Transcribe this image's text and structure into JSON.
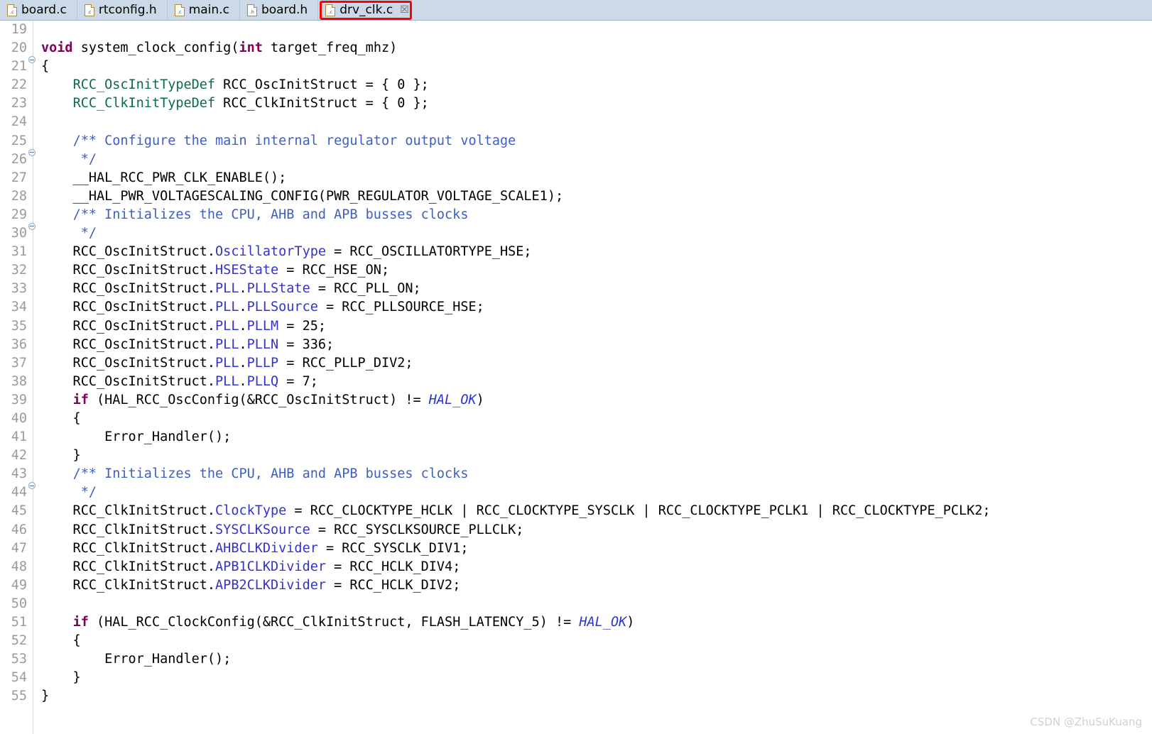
{
  "tabbar": {
    "tabs": [
      {
        "label": "board.c",
        "ext": ".c",
        "kind": "c",
        "active": false,
        "closable": false
      },
      {
        "label": "rtconfig.h",
        "ext": ".c",
        "kind": "c",
        "active": false,
        "closable": false
      },
      {
        "label": "main.c",
        "ext": ".c",
        "kind": "c",
        "active": false,
        "closable": false
      },
      {
        "label": "board.h",
        "ext": ".h",
        "kind": "h",
        "active": false,
        "closable": false
      },
      {
        "label": "drv_clk.c",
        "ext": ".c",
        "kind": "c",
        "active": true,
        "closable": true
      }
    ],
    "close_glyph": "☒",
    "highlight_color": "#ff0000"
  },
  "editor": {
    "language": "C",
    "first_line": 19,
    "last_line": 55,
    "fold_lines": [
      20,
      25,
      29,
      43
    ],
    "fold_glyph": "⊖",
    "colors": {
      "keyword": "#7f0055",
      "type": "#0a6b4a",
      "member": "#3333cc",
      "comment": "#3f5fbf",
      "enum_constant": "#2a36c8",
      "text": "#000000",
      "line_number": "#9a9a9a",
      "background": "#ffffff",
      "tab_background": "#ccd9e8"
    },
    "lines": [
      {
        "n": 19,
        "fold": false,
        "tokens": []
      },
      {
        "n": 20,
        "fold": true,
        "tokens": [
          {
            "t": "kw",
            "s": "void"
          },
          {
            "t": "p",
            "s": " system_clock_config("
          },
          {
            "t": "kw",
            "s": "int"
          },
          {
            "t": "p",
            "s": " target_freq_mhz)"
          }
        ]
      },
      {
        "n": 21,
        "fold": false,
        "tokens": [
          {
            "t": "p",
            "s": "{"
          }
        ]
      },
      {
        "n": 22,
        "fold": false,
        "tokens": [
          {
            "t": "p",
            "s": "    "
          },
          {
            "t": "type",
            "s": "RCC_OscInitTypeDef"
          },
          {
            "t": "p",
            "s": " RCC_OscInitStruct = { 0 };"
          }
        ]
      },
      {
        "n": 23,
        "fold": false,
        "tokens": [
          {
            "t": "p",
            "s": "    "
          },
          {
            "t": "type",
            "s": "RCC_ClkInitTypeDef"
          },
          {
            "t": "p",
            "s": " RCC_ClkInitStruct = { 0 };"
          }
        ]
      },
      {
        "n": 24,
        "fold": false,
        "tokens": []
      },
      {
        "n": 25,
        "fold": true,
        "tokens": [
          {
            "t": "p",
            "s": "    "
          },
          {
            "t": "cmt",
            "s": "/** Configure the main internal regulator output voltage"
          }
        ]
      },
      {
        "n": 26,
        "fold": false,
        "tokens": [
          {
            "t": "p",
            "s": "     "
          },
          {
            "t": "cmt",
            "s": "*/"
          }
        ]
      },
      {
        "n": 27,
        "fold": false,
        "tokens": [
          {
            "t": "p",
            "s": "    __HAL_RCC_PWR_CLK_ENABLE();"
          }
        ]
      },
      {
        "n": 28,
        "fold": false,
        "tokens": [
          {
            "t": "p",
            "s": "    __HAL_PWR_VOLTAGESCALING_CONFIG(PWR_REGULATOR_VOLTAGE_SCALE1);"
          }
        ]
      },
      {
        "n": 29,
        "fold": true,
        "tokens": [
          {
            "t": "p",
            "s": "    "
          },
          {
            "t": "cmt",
            "s": "/** Initializes the CPU, AHB and APB busses clocks"
          }
        ]
      },
      {
        "n": 30,
        "fold": false,
        "tokens": [
          {
            "t": "p",
            "s": "     "
          },
          {
            "t": "cmt",
            "s": "*/"
          }
        ]
      },
      {
        "n": 31,
        "fold": false,
        "tokens": [
          {
            "t": "p",
            "s": "    RCC_OscInitStruct."
          },
          {
            "t": "mem",
            "s": "OscillatorType"
          },
          {
            "t": "p",
            "s": " = RCC_OSCILLATORTYPE_HSE;"
          }
        ]
      },
      {
        "n": 32,
        "fold": false,
        "tokens": [
          {
            "t": "p",
            "s": "    RCC_OscInitStruct."
          },
          {
            "t": "mem",
            "s": "HSEState"
          },
          {
            "t": "p",
            "s": " = RCC_HSE_ON;"
          }
        ]
      },
      {
        "n": 33,
        "fold": false,
        "tokens": [
          {
            "t": "p",
            "s": "    RCC_OscInitStruct."
          },
          {
            "t": "mem",
            "s": "PLL"
          },
          {
            "t": "p",
            "s": "."
          },
          {
            "t": "mem",
            "s": "PLLState"
          },
          {
            "t": "p",
            "s": " = RCC_PLL_ON;"
          }
        ]
      },
      {
        "n": 34,
        "fold": false,
        "tokens": [
          {
            "t": "p",
            "s": "    RCC_OscInitStruct."
          },
          {
            "t": "mem",
            "s": "PLL"
          },
          {
            "t": "p",
            "s": "."
          },
          {
            "t": "mem",
            "s": "PLLSource"
          },
          {
            "t": "p",
            "s": " = RCC_PLLSOURCE_HSE;"
          }
        ]
      },
      {
        "n": 35,
        "fold": false,
        "tokens": [
          {
            "t": "p",
            "s": "    RCC_OscInitStruct."
          },
          {
            "t": "mem",
            "s": "PLL"
          },
          {
            "t": "p",
            "s": "."
          },
          {
            "t": "mem",
            "s": "PLLM"
          },
          {
            "t": "p",
            "s": " = 25;"
          }
        ]
      },
      {
        "n": 36,
        "fold": false,
        "tokens": [
          {
            "t": "p",
            "s": "    RCC_OscInitStruct."
          },
          {
            "t": "mem",
            "s": "PLL"
          },
          {
            "t": "p",
            "s": "."
          },
          {
            "t": "mem",
            "s": "PLLN"
          },
          {
            "t": "p",
            "s": " = 336;"
          }
        ]
      },
      {
        "n": 37,
        "fold": false,
        "tokens": [
          {
            "t": "p",
            "s": "    RCC_OscInitStruct."
          },
          {
            "t": "mem",
            "s": "PLL"
          },
          {
            "t": "p",
            "s": "."
          },
          {
            "t": "mem",
            "s": "PLLP"
          },
          {
            "t": "p",
            "s": " = RCC_PLLP_DIV2;"
          }
        ]
      },
      {
        "n": 38,
        "fold": false,
        "tokens": [
          {
            "t": "p",
            "s": "    RCC_OscInitStruct."
          },
          {
            "t": "mem",
            "s": "PLL"
          },
          {
            "t": "p",
            "s": "."
          },
          {
            "t": "mem",
            "s": "PLLQ"
          },
          {
            "t": "p",
            "s": " = 7;"
          }
        ]
      },
      {
        "n": 39,
        "fold": false,
        "tokens": [
          {
            "t": "p",
            "s": "    "
          },
          {
            "t": "kw",
            "s": "if"
          },
          {
            "t": "p",
            "s": " (HAL_RCC_OscConfig(&RCC_OscInitStruct) != "
          },
          {
            "t": "enm",
            "s": "HAL_OK"
          },
          {
            "t": "p",
            "s": ")"
          }
        ]
      },
      {
        "n": 40,
        "fold": false,
        "tokens": [
          {
            "t": "p",
            "s": "    {"
          }
        ]
      },
      {
        "n": 41,
        "fold": false,
        "tokens": [
          {
            "t": "p",
            "s": "        Error_Handler();"
          }
        ]
      },
      {
        "n": 42,
        "fold": false,
        "tokens": [
          {
            "t": "p",
            "s": "    }"
          }
        ]
      },
      {
        "n": 43,
        "fold": true,
        "tokens": [
          {
            "t": "p",
            "s": "    "
          },
          {
            "t": "cmt",
            "s": "/** Initializes the CPU, AHB and APB busses clocks"
          }
        ]
      },
      {
        "n": 44,
        "fold": false,
        "tokens": [
          {
            "t": "p",
            "s": "     "
          },
          {
            "t": "cmt",
            "s": "*/"
          }
        ]
      },
      {
        "n": 45,
        "fold": false,
        "tokens": [
          {
            "t": "p",
            "s": "    RCC_ClkInitStruct."
          },
          {
            "t": "mem",
            "s": "ClockType"
          },
          {
            "t": "p",
            "s": " = RCC_CLOCKTYPE_HCLK | RCC_CLOCKTYPE_SYSCLK | RCC_CLOCKTYPE_PCLK1 | RCC_CLOCKTYPE_PCLK2;"
          }
        ]
      },
      {
        "n": 46,
        "fold": false,
        "tokens": [
          {
            "t": "p",
            "s": "    RCC_ClkInitStruct."
          },
          {
            "t": "mem",
            "s": "SYSCLKSource"
          },
          {
            "t": "p",
            "s": " = RCC_SYSCLKSOURCE_PLLCLK;"
          }
        ]
      },
      {
        "n": 47,
        "fold": false,
        "tokens": [
          {
            "t": "p",
            "s": "    RCC_ClkInitStruct."
          },
          {
            "t": "mem",
            "s": "AHBCLKDivider"
          },
          {
            "t": "p",
            "s": " = RCC_SYSCLK_DIV1;"
          }
        ]
      },
      {
        "n": 48,
        "fold": false,
        "tokens": [
          {
            "t": "p",
            "s": "    RCC_ClkInitStruct."
          },
          {
            "t": "mem",
            "s": "APB1CLKDivider"
          },
          {
            "t": "p",
            "s": " = RCC_HCLK_DIV4;"
          }
        ]
      },
      {
        "n": 49,
        "fold": false,
        "tokens": [
          {
            "t": "p",
            "s": "    RCC_ClkInitStruct."
          },
          {
            "t": "mem",
            "s": "APB2CLKDivider"
          },
          {
            "t": "p",
            "s": " = RCC_HCLK_DIV2;"
          }
        ]
      },
      {
        "n": 50,
        "fold": false,
        "tokens": []
      },
      {
        "n": 51,
        "fold": false,
        "tokens": [
          {
            "t": "p",
            "s": "    "
          },
          {
            "t": "kw",
            "s": "if"
          },
          {
            "t": "p",
            "s": " (HAL_RCC_ClockConfig(&RCC_ClkInitStruct, FLASH_LATENCY_5) != "
          },
          {
            "t": "enm",
            "s": "HAL_OK"
          },
          {
            "t": "p",
            "s": ")"
          }
        ]
      },
      {
        "n": 52,
        "fold": false,
        "tokens": [
          {
            "t": "p",
            "s": "    {"
          }
        ]
      },
      {
        "n": 53,
        "fold": false,
        "tokens": [
          {
            "t": "p",
            "s": "        Error_Handler();"
          }
        ]
      },
      {
        "n": 54,
        "fold": false,
        "tokens": [
          {
            "t": "p",
            "s": "    }"
          }
        ]
      },
      {
        "n": 55,
        "fold": false,
        "tokens": [
          {
            "t": "p",
            "s": "}"
          }
        ]
      }
    ]
  },
  "watermark": {
    "text": "CSDN @ZhuSuKuang"
  }
}
